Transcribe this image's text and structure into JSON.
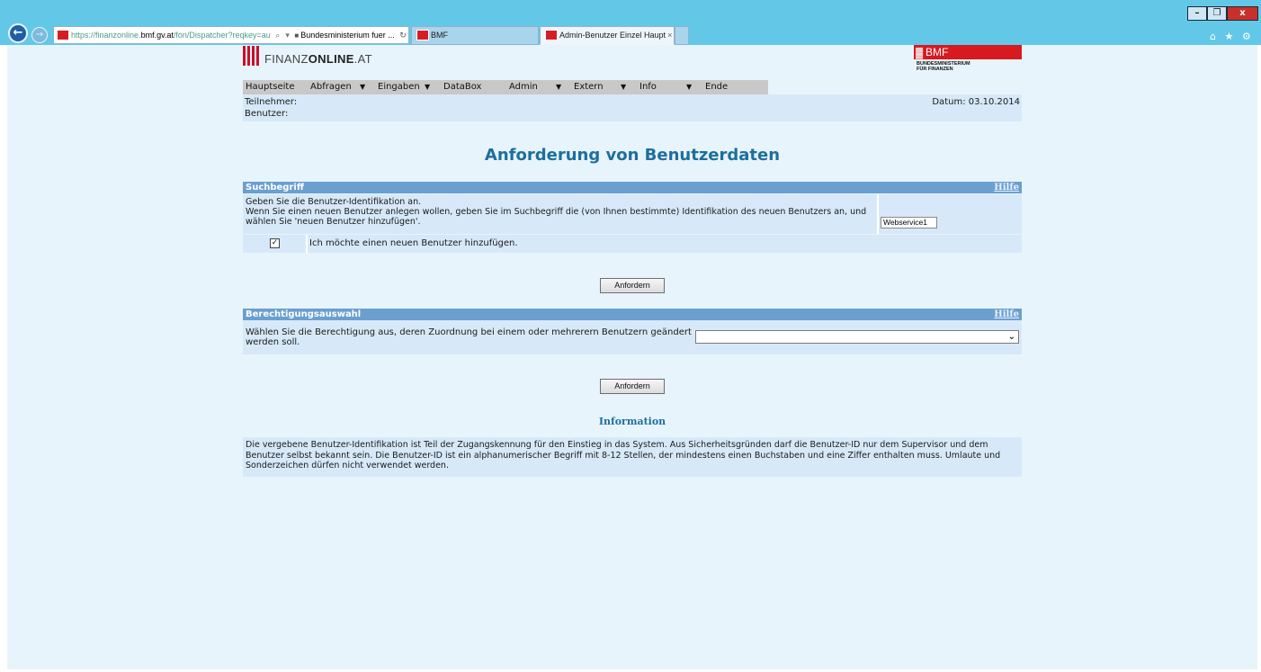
{
  "browser": {
    "url_prefix": "https://finanzonline.",
    "url_domain": "bmf.gv.at",
    "url_path": "/fon/Dispatcher?reqkey=au",
    "search_glyph": "⌕",
    "dropdown_glyph": "▾",
    "cert_label": "Bundesministerium fuer ...",
    "refresh_glyph": "↻",
    "tabs": [
      {
        "label": "BMF"
      },
      {
        "label": "Admin-Benutzer Einzel Haupt",
        "close": "×"
      }
    ],
    "window_controls": [
      "–",
      "❐",
      "x"
    ],
    "right_icons": "⌂ ★ ⚙"
  },
  "header": {
    "logo_text_light": "FINANZ",
    "logo_text_bold": "ONLINE",
    "logo_text_suffix": ".AT",
    "bmf_logo": "BMF",
    "bmf_sub_line1": "BUNDESMINISTERIUM",
    "bmf_sub_line2": "FÜR FINANZEN"
  },
  "menu": {
    "items": [
      {
        "label": "Hauptseite",
        "caret": ""
      },
      {
        "label": "Abfragen",
        "caret": "▼"
      },
      {
        "label": "Eingaben",
        "caret": "▼"
      },
      {
        "label": "DataBox",
        "caret": ""
      },
      {
        "label": "Admin",
        "caret": "▼"
      },
      {
        "label": "Extern",
        "caret": "▼"
      },
      {
        "label": "Info",
        "caret": "▼"
      },
      {
        "label": "Ende",
        "caret": ""
      }
    ]
  },
  "user_info": {
    "teilnehmer_label": "Teilnehmer:",
    "benutzer_label": "Benutzer:",
    "date_text": "Datum: 03.10.2014"
  },
  "page_title": "Anforderung von Benutzerdaten",
  "suchbegriff": {
    "heading": "Suchbegriff",
    "help": "Hilfe",
    "line1": "Geben Sie die Benutzer-Identifikation an.",
    "line2": "Wenn Sie einen neuen Benutzer anlegen wollen, geben Sie im Suchbegriff die (von Ihnen bestimmte) Identifikation des neuen Benutzers an, und",
    "line3": "wählen Sie 'neuen Benutzer hinzufügen'.",
    "input_value": "Webservice1",
    "checkbox_checked": true,
    "checkbox_glyph": "✓",
    "checkbox_label": "Ich möchte einen neuen Benutzer hinzufügen.",
    "button_label": "Anfordern"
  },
  "berechtigung": {
    "heading": "Berechtigungsauswahl",
    "help": "Hilfe",
    "line1": "Wählen Sie die Berechtigung aus, deren Zuordnung bei einem oder mehrerern Benutzern geändert",
    "line2": "werden soll.",
    "select_value": "",
    "select_glyph": "⌄",
    "button_label": "Anfordern"
  },
  "information": {
    "heading": "Information",
    "line1": "Die vergebene Benutzer-Identifikation ist Teil der Zugangskennung für den Einstieg in das System. Aus Sicherheitsgründen darf die Benutzer-ID nur dem Supervisor und dem",
    "line2": "Benutzer selbst bekannt sein. Die Benutzer-ID ist ein alphanumerischer Begriff mit 8-12 Stellen, der mindestens einen Buchstaben und eine Ziffer enthalten muss. Umlaute und",
    "line3": "Sonderzeichen dürfen nicht verwendet werden."
  }
}
